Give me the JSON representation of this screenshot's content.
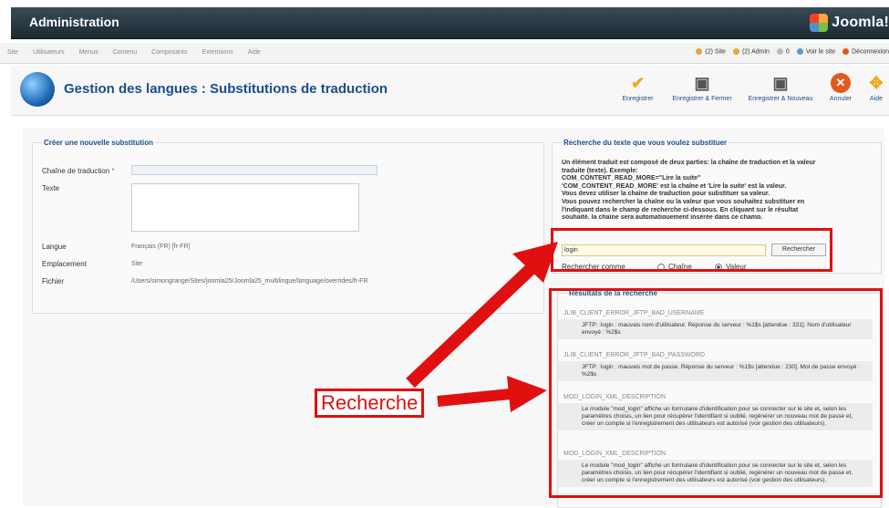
{
  "header": {
    "title": "Administration",
    "logo_text": "Joomla!"
  },
  "menu": {
    "items": [
      "Site",
      "Utilisateurs",
      "Menus",
      "Contenu",
      "Composants",
      "Extensions",
      "Aide"
    ],
    "status": [
      "(2) Site",
      "(2) Admin",
      "0",
      "Voir le site",
      "Déconnexion"
    ]
  },
  "toolbar": {
    "title": "Gestion des langues : Substitutions de traduction",
    "buttons": [
      "Enregistrer",
      "Enregistrer & Fermer",
      "Enregistrer & Nouveau",
      "Annuler",
      "Aide"
    ]
  },
  "form": {
    "legend": "Créer une nouvelle substitution",
    "chaine_label": "Chaîne de traduction",
    "required_mark": "*",
    "texte_label": "Texte",
    "langue_label": "Langue",
    "langue_value": "Français (FR) [fr-FR]",
    "emplacement_label": "Emplacement",
    "emplacement_value": "Site",
    "fichier_label": "Fichier",
    "fichier_value": "/Users/simongrange/Sites/joomla25/Joomla25_multilingue/language/overrides/fr-FR"
  },
  "search": {
    "legend": "Recherche du texte que vous voulez substituer",
    "help_lines": [
      "Un élément traduit est composé de deux parties: la chaîne de traduction et la valeur",
      "traduite (texte). Exemple:",
      "COM_CONTENT_READ_MORE=\"Lire la suite\"",
      "'COM_CONTENT_READ_MORE' est la chaîne et 'Lire la suite' est la valeur.",
      "Vous devez utiliser la chaîne de traduction pour substituer sa valeur.",
      "Vous pouvez rechercher la chaîne ou la valeur que vous souhaitez substituer en",
      "l'indiquant dans le champ de recherche ci-dessous. En cliquant sur le résultat",
      "souhaité, la chaîne sera automatiquement insérée dans ce champ."
    ],
    "query": "login",
    "button": "Rechercher",
    "mode_label": "Rechercher comme",
    "opt_chaine": "Chaîne",
    "opt_valeur": "Valeur",
    "selected": "Valeur"
  },
  "results": {
    "legend": "Résultats de la recherche",
    "items": [
      {
        "key": "JLIB_CLIENT_ERROR_JFTP_BAD_USERNAME",
        "text": "JFTP: :login : mauvais nom d'utilisateur. Réponse du serveur : %1$s [attendue : 331]. Nom d'utilisateur envoyé : %2$s"
      },
      {
        "key": "JLIB_CLIENT_ERROR_JFTP_BAD_PASSWORD",
        "text": "JFTP: :login : mauvais mot de passe. Réponse du serveur : %1$s [attendue : 230]. Mot de passe envoyé : %2$s"
      },
      {
        "key": "MOD_LOGIN_XML_DESCRIPTION",
        "text": "Le module \"mod_login\" affiche un formulaire d'identification pour se connecter sur le site et, selon les paramètres choisis, un lien pour récupérer l'identifiant si oublié, regénérer un nouveau mot de passe et, créer un compte si l'enregistrement des utilisateurs est autorisé (voir gestion des utilisateurs)."
      },
      {
        "key": "MOD_LOGIN_XML_DESCRIPTION",
        "text": "Le module \"mod_login\" affiche un formulaire d'identification pour se connecter sur le site et, selon les paramètres choisis, un lien pour récupérer l'identifiant si oublié, regénérer un nouveau mot de passe et, créer un compte si l'enregistrement des utilisateurs est autorisé (voir gestion des utilisateurs)."
      }
    ]
  },
  "annotation": {
    "label": "Recherche",
    "color": "#e01010"
  }
}
